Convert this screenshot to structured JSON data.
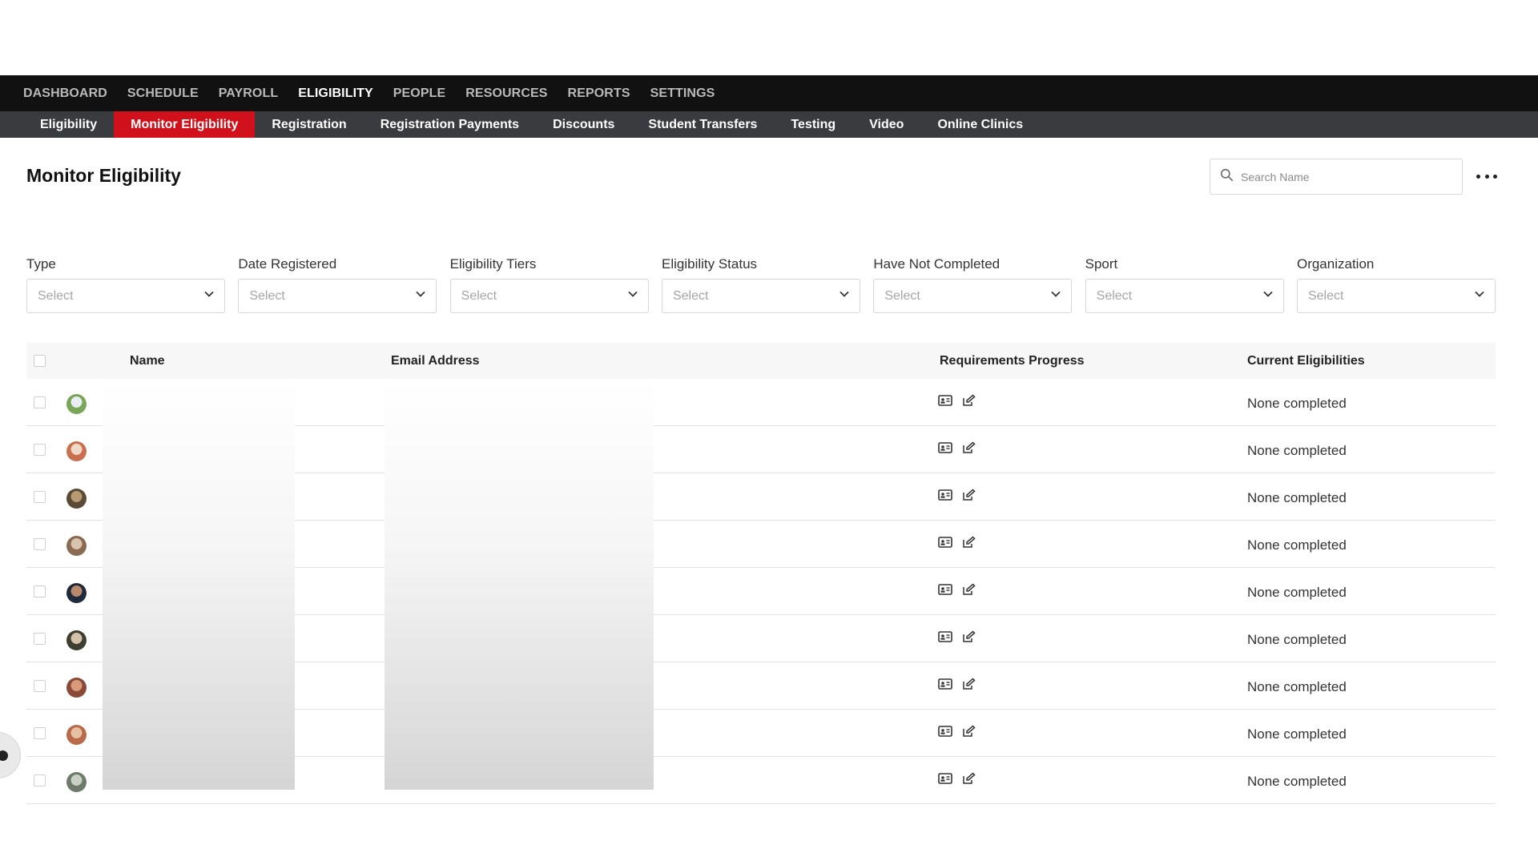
{
  "top_nav": {
    "items": [
      {
        "label": "DASHBOARD",
        "active": false
      },
      {
        "label": "SCHEDULE",
        "active": false
      },
      {
        "label": "PAYROLL",
        "active": false
      },
      {
        "label": "ELIGIBILITY",
        "active": true
      },
      {
        "label": "PEOPLE",
        "active": false
      },
      {
        "label": "RESOURCES",
        "active": false
      },
      {
        "label": "REPORTS",
        "active": false
      },
      {
        "label": "SETTINGS",
        "active": false
      }
    ]
  },
  "sub_nav": {
    "items": [
      {
        "label": "Eligibility",
        "active": false
      },
      {
        "label": "Monitor Eligibility",
        "active": true
      },
      {
        "label": "Registration",
        "active": false
      },
      {
        "label": "Registration Payments",
        "active": false
      },
      {
        "label": "Discounts",
        "active": false
      },
      {
        "label": "Student Transfers",
        "active": false
      },
      {
        "label": "Testing",
        "active": false
      },
      {
        "label": "Video",
        "active": false
      },
      {
        "label": "Online Clinics",
        "active": false
      }
    ]
  },
  "page": {
    "title": "Monitor Eligibility"
  },
  "search": {
    "placeholder": "Search Name",
    "value": ""
  },
  "filters": [
    {
      "label": "Type",
      "value": "Select"
    },
    {
      "label": "Date Registered",
      "value": "Select"
    },
    {
      "label": "Eligibility Tiers",
      "value": "Select"
    },
    {
      "label": "Eligibility Status",
      "value": "Select"
    },
    {
      "label": "Have Not Completed",
      "value": "Select"
    },
    {
      "label": "Sport",
      "value": "Select"
    },
    {
      "label": "Organization",
      "value": "Select"
    }
  ],
  "table": {
    "columns": {
      "name": "Name",
      "email": "Email Address",
      "requirements": "Requirements Progress",
      "eligibilities": "Current Eligibilities"
    },
    "rows": [
      {
        "eligibility": "None completed"
      },
      {
        "eligibility": "None completed"
      },
      {
        "eligibility": "None completed"
      },
      {
        "eligibility": "None completed"
      },
      {
        "eligibility": "None completed"
      },
      {
        "eligibility": "None completed"
      },
      {
        "eligibility": "None completed"
      },
      {
        "eligibility": "None completed"
      },
      {
        "eligibility": "None completed"
      }
    ]
  },
  "colors": {
    "top_nav_bg": "#111111",
    "sub_nav_bg": "#3a3b3e",
    "active_accent": "#d0111b"
  },
  "icons": {
    "search": "search-icon",
    "more": "more-horizontal-icon",
    "dropdown": "chevron-down-icon",
    "id_card": "id-card-icon",
    "edit": "edit-icon"
  }
}
